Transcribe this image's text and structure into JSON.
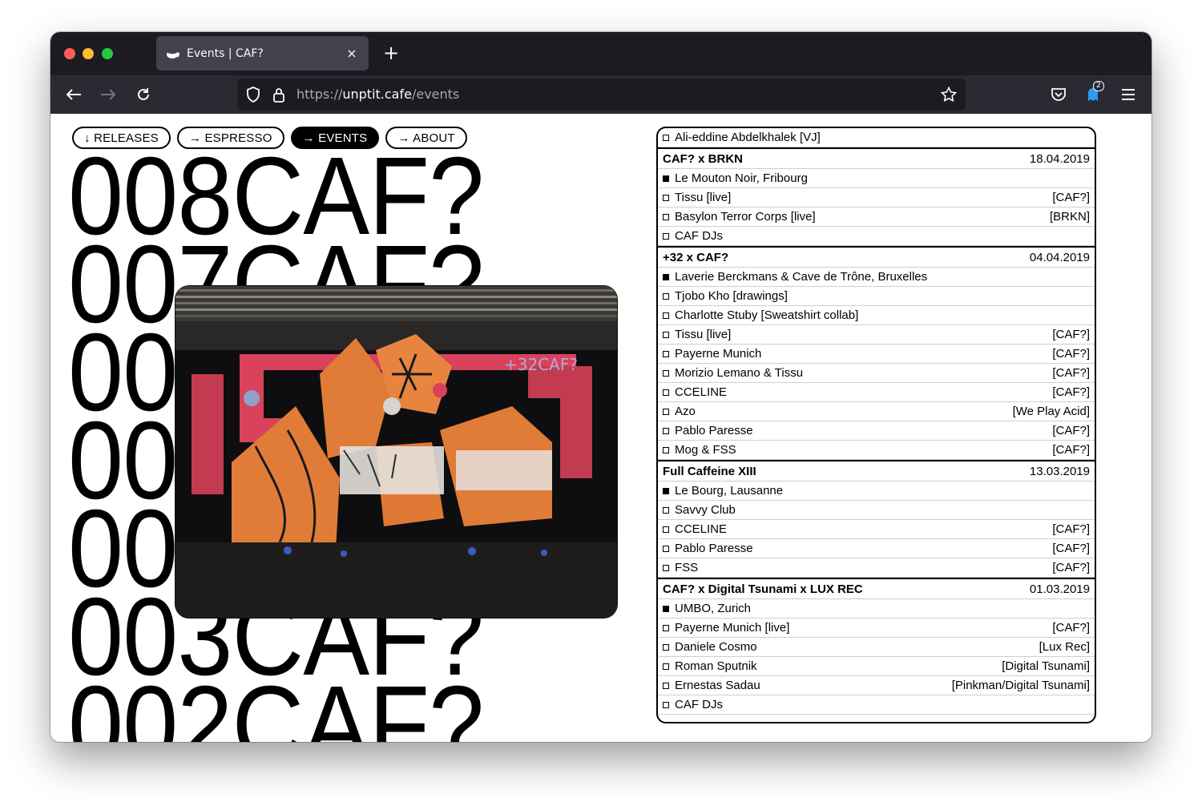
{
  "browser": {
    "tab_title": "Events | CAF?",
    "url_scheme": "https://",
    "url_host": "unptit.cafe",
    "url_path": "/events",
    "extension_badge": "2",
    "new_tab_label": "+",
    "close_label": "×"
  },
  "nav": [
    {
      "label": "↓ RELEASES",
      "active": false
    },
    {
      "label": "→ ESPRESSO",
      "active": false
    },
    {
      "label": "→ EVENTS",
      "active": true
    },
    {
      "label": "→ ABOUT",
      "active": false
    }
  ],
  "big_labels": [
    "008CAF?",
    "007CAF?",
    "006CAF?",
    "005CAF?",
    "004CAF?",
    "003CAF?",
    "002CAF?"
  ],
  "photo_tag": "+32CAF?",
  "events_top_item": "Ali-eddine Abdelkhalek [VJ]",
  "events": [
    {
      "title": "CAF? x BRKN",
      "date": "18.04.2019",
      "venue": "Le Mouton Noir, Fribourg",
      "lineup": [
        {
          "name": "Tissu [live]",
          "label": "[CAF?]"
        },
        {
          "name": "Basylon Terror Corps [live]",
          "label": "[BRKN]"
        },
        {
          "name": "CAF DJs",
          "label": ""
        }
      ]
    },
    {
      "title": "+32 x CAF?",
      "date": "04.04.2019",
      "venue": "Laverie Berckmans & Cave de Trône, Bruxelles",
      "lineup": [
        {
          "name": "Tjobo Kho [drawings]",
          "label": ""
        },
        {
          "name": "Charlotte Stuby [Sweatshirt collab]",
          "label": ""
        },
        {
          "name": "Tissu [live]",
          "label": "[CAF?]"
        },
        {
          "name": "Payerne Munich",
          "label": "[CAF?]"
        },
        {
          "name": "Morizio Lemano & Tissu",
          "label": "[CAF?]"
        },
        {
          "name": "CCELINE",
          "label": "[CAF?]"
        },
        {
          "name": "Azo",
          "label": "[We Play Acid]"
        },
        {
          "name": "Pablo Paresse",
          "label": "[CAF?]"
        },
        {
          "name": "Mog & FSS",
          "label": "[CAF?]"
        }
      ]
    },
    {
      "title": "Full Caffeine XIII",
      "date": "13.03.2019",
      "venue": "Le Bourg, Lausanne",
      "lineup": [
        {
          "name": "Savvy Club",
          "label": ""
        },
        {
          "name": "CCELINE",
          "label": "[CAF?]"
        },
        {
          "name": "Pablo Paresse",
          "label": "[CAF?]"
        },
        {
          "name": "FSS",
          "label": "[CAF?]"
        }
      ]
    },
    {
      "title": "CAF? x Digital Tsunami x LUX REC",
      "date": "01.03.2019",
      "venue": "UMBO, Zurich",
      "lineup": [
        {
          "name": "Payerne Munich [live]",
          "label": "[CAF?]"
        },
        {
          "name": "Daniele Cosmo",
          "label": "[Lux Rec]"
        },
        {
          "name": "Roman Sputnik",
          "label": "[Digital Tsunami]"
        },
        {
          "name": "Ernestas Sadau",
          "label": "[Pinkman/Digital Tsunami]"
        },
        {
          "name": "CAF DJs",
          "label": ""
        }
      ]
    }
  ],
  "colors": {
    "tabbar_bg": "#1c1b22",
    "navbar_bg": "#2b2a33",
    "accent": "#000000"
  }
}
